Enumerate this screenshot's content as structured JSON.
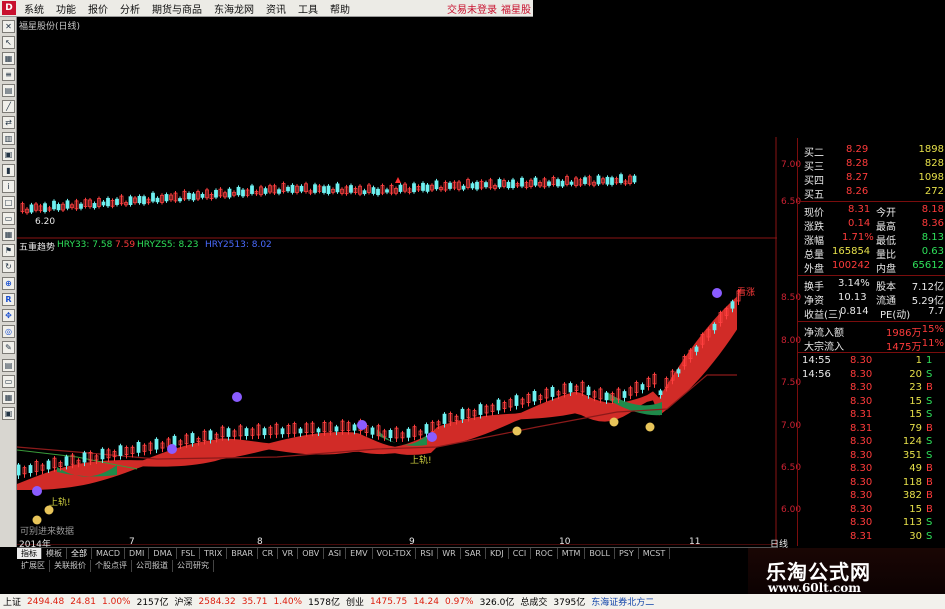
{
  "menu": {
    "items": [
      "系统",
      "功能",
      "报价",
      "分析",
      "期货与商品",
      "东海龙网",
      "资讯",
      "工具",
      "帮助"
    ],
    "status": "交易未登录",
    "stock_short": "福星股"
  },
  "chart": {
    "title": "福星股份(日线)",
    "indicator_name": "五重趋势",
    "ind1_label": "HRY33: 7.58",
    "ind2_label": "7.59",
    "ind3_label": "HRYZS5: 8.23",
    "ind4_label": "HRY2513: 8.02",
    "low_label": "6.20",
    "signal_up": "上轨!",
    "signal_dn": "上轨!",
    "signal_watch": "看涨",
    "note": "可别进来数据",
    "date_labels": [
      "2014年",
      "7",
      "8",
      "9",
      "10",
      "11"
    ],
    "period_label": "日线"
  },
  "axis_top": [
    "7.00",
    "6.50"
  ],
  "axis_bottom": [
    "8.50",
    "8.00",
    "7.50",
    "7.00",
    "6.50",
    "6.00"
  ],
  "quote": {
    "asks": [
      {
        "label": "买二",
        "price": "8.29",
        "vol": "1898"
      },
      {
        "label": "买三",
        "price": "8.28",
        "vol": "828"
      },
      {
        "label": "买四",
        "price": "8.27",
        "vol": "1098"
      },
      {
        "label": "买五",
        "price": "8.26",
        "vol": "272"
      }
    ],
    "stats": [
      {
        "l1": "现价",
        "v1": "8.31",
        "l2": "今开",
        "v2": "8.18"
      },
      {
        "l1": "涨跌",
        "v1": "0.14",
        "l2": "最高",
        "v2": "8.36"
      },
      {
        "l1": "涨幅",
        "v1": "1.71%",
        "l2": "最低",
        "v2": "8.13"
      },
      {
        "l1": "总量",
        "v1": "165854",
        "l2": "量比",
        "v2": "0.63"
      },
      {
        "l1": "外盘",
        "v1": "100242",
        "l2": "内盘",
        "v2": "65612"
      }
    ],
    "fund": [
      {
        "l1": "换手",
        "v1": "3.14%",
        "l2": "股本",
        "v2": "7.12亿"
      },
      {
        "l1": "净资",
        "v1": "10.13",
        "l2": "流通",
        "v2": "5.29亿"
      },
      {
        "l1": "收益(三)",
        "v1": "0.814",
        "l2": "PE(动)",
        "v2": "7.7"
      }
    ],
    "flows": [
      {
        "label": "净流入额",
        "value": "1986万",
        "pct": "15%"
      },
      {
        "label": "大宗流入",
        "value": "1475万",
        "pct": "11%"
      }
    ],
    "ticks": [
      {
        "time": "14:55",
        "price": "8.30",
        "vol": "1",
        "flag": "1"
      },
      {
        "time": "14:56",
        "price": "8.30",
        "vol": "20",
        "flag": "S"
      },
      {
        "time": "",
        "price": "8.30",
        "vol": "23",
        "flag": "B"
      },
      {
        "time": "",
        "price": "8.30",
        "vol": "15",
        "flag": "S"
      },
      {
        "time": "",
        "price": "8.31",
        "vol": "15",
        "flag": "S"
      },
      {
        "time": "",
        "price": "8.31",
        "vol": "79",
        "flag": "B"
      },
      {
        "time": "",
        "price": "8.30",
        "vol": "124",
        "flag": "S"
      },
      {
        "time": "",
        "price": "8.30",
        "vol": "351",
        "flag": "S"
      },
      {
        "time": "",
        "price": "8.30",
        "vol": "49",
        "flag": "B"
      },
      {
        "time": "",
        "price": "8.30",
        "vol": "118",
        "flag": "B"
      },
      {
        "time": "",
        "price": "8.30",
        "vol": "382",
        "flag": "B"
      },
      {
        "time": "",
        "price": "8.30",
        "vol": "15",
        "flag": "B"
      },
      {
        "time": "",
        "price": "8.30",
        "vol": "113",
        "flag": "S"
      },
      {
        "time": "",
        "price": "8.31",
        "vol": "30",
        "flag": "S"
      }
    ]
  },
  "tabs": [
    "指标",
    "模板",
    "全部",
    "MACD",
    "DMI",
    "DMA",
    "FSL",
    "TRIX",
    "BRAR",
    "CR",
    "VR",
    "OBV",
    "ASI",
    "EMV",
    "VOL-TDX",
    "RSI",
    "WR",
    "SAR",
    "KDJ",
    "CCI",
    "ROC",
    "MTM",
    "BOLL",
    "PSY",
    "MCST"
  ],
  "subtabs": [
    "扩展区",
    "关联报价",
    "个股点评",
    "公司报道",
    "公司研究"
  ],
  "status": [
    {
      "label": "上证",
      "value": "2494.48",
      "chg": "24.81",
      "pct": "1.00%",
      "amt": "2157亿"
    },
    {
      "label": "沪深",
      "value": "2584.32",
      "chg": "35.71",
      "pct": "1.40%",
      "amt": "1578亿"
    },
    {
      "label": "创业",
      "value": "1475.75",
      "chg": "14.24",
      "pct": "0.97%",
      "amt": "326.0亿"
    }
  ],
  "status_extra": [
    "总成交",
    "3795亿",
    "东海证券北方二"
  ],
  "watermark": {
    "title": "乐淘公式网",
    "url": "www.60lt.com"
  },
  "colors": {
    "up": "#ff3b3b",
    "down": "#2ee05a",
    "ribbon_up": "#e8302b",
    "ribbon_down": "#1f8a4a"
  }
}
